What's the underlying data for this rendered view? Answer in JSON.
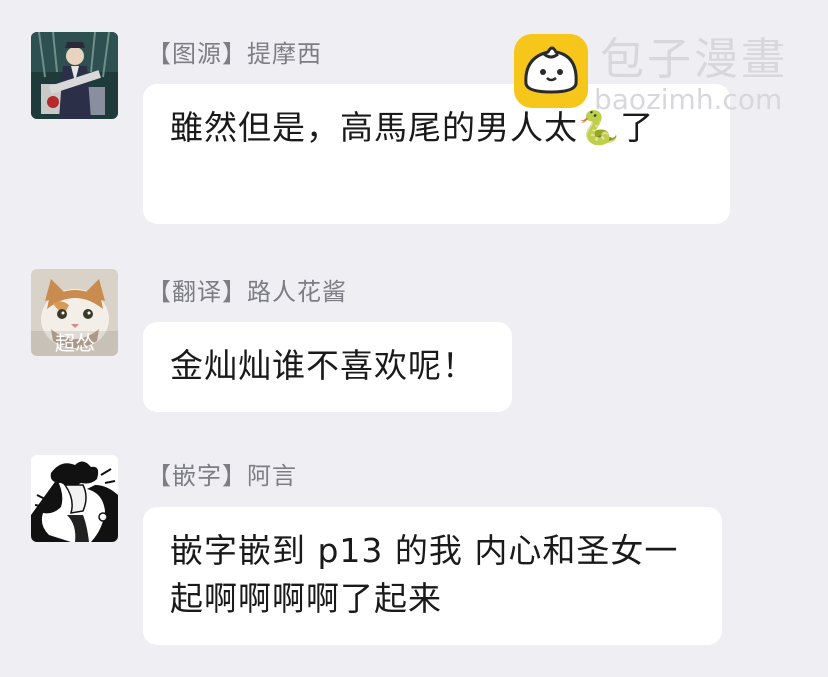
{
  "messages": [
    {
      "sender": "【图源】提摩西",
      "text": "雖然但是，高馬尾的男人太🐍了",
      "avatar": "avatar-illustrated-man-icon"
    },
    {
      "sender": "【翻译】路人花酱",
      "text": "金灿灿谁不喜欢呢！",
      "avatar": "avatar-cat-icon",
      "avatar_caption": "超怂"
    },
    {
      "sender": "【嵌字】阿言",
      "text": "嵌字嵌到 p13 的我 内心和圣女一起啊啊啊啊了起来",
      "avatar": "avatar-manga-sketch-icon"
    }
  ],
  "watermark": {
    "name": "包子漫畫",
    "domain": "baozimh.com",
    "logo": "bun-logo-icon"
  },
  "colors": {
    "background": "#eeeef3",
    "bubble": "#ffffff",
    "sender_text": "#7d7d84",
    "message_text": "#1a1a1a",
    "logo_yellow": "#f6c61a"
  }
}
